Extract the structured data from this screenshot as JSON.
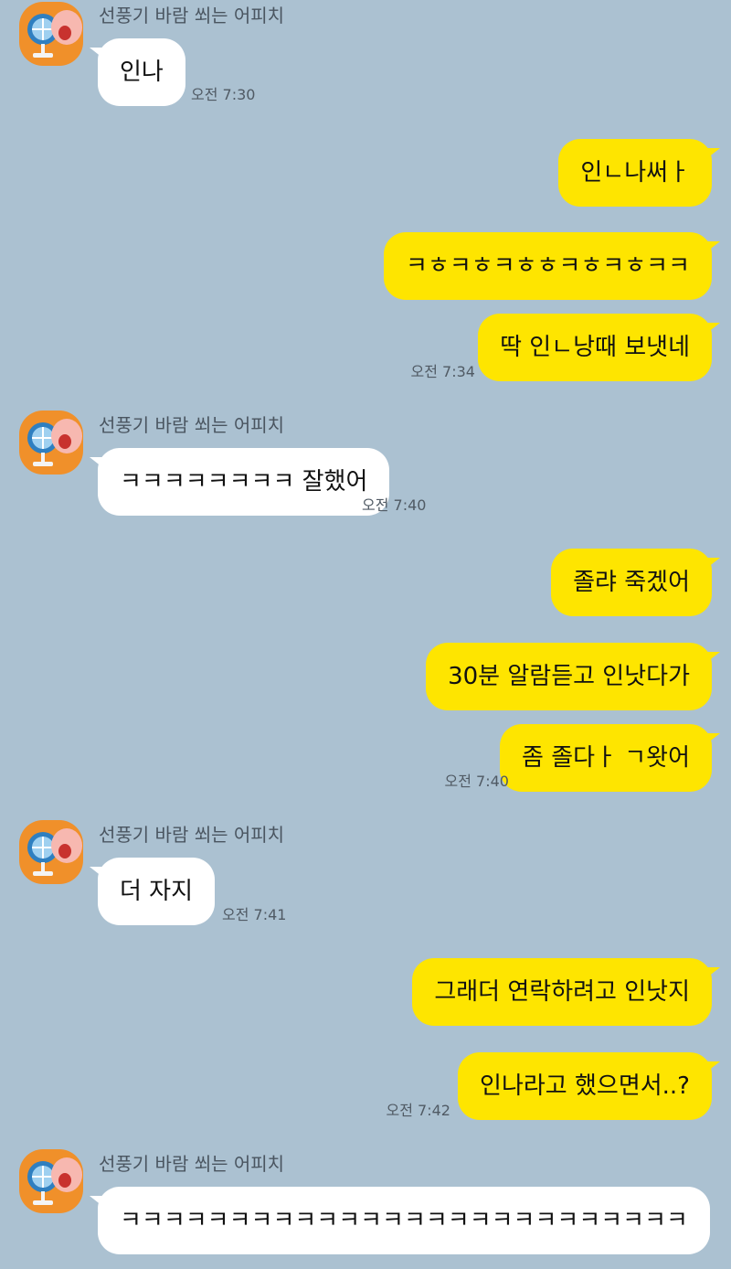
{
  "chat": {
    "contact_name": "선풍기 바람 쐬는 어피치",
    "groups": [
      {
        "messages": [
          "인나"
        ],
        "time": "오전 7:30"
      },
      {
        "messages": [
          "인ㄴ나써ㅏ",
          "ㅋㅎㅋㅎㅋㅎㅎㅋㅎㅋㅎㅋㅋ",
          "딱 인ㄴ낭때 보냇네"
        ],
        "time": "오전 7:34"
      },
      {
        "messages": [
          "ㅋㅋㅋㅋㅋㅋㅋㅋ 잘했어"
        ],
        "time": "오전 7:40"
      },
      {
        "messages": [
          "졸랴 죽겠어",
          "30분 알람듣고 인낫다가",
          "좀 졸다ㅏ ㄱ왓어"
        ],
        "time": "오전 7:40"
      },
      {
        "messages": [
          "더 자지"
        ],
        "time": "오전 7:41"
      },
      {
        "messages": [
          "그래더 연락하려고 인낫지",
          "인나라고 했으면서..?"
        ],
        "time": "오전 7:42"
      },
      {
        "messages": [
          "ㅋㅋㅋㅋㅋㅋㅋㅋㅋㅋㅋㅋㅋㅋㅋㅋㅋㅋㅋㅋㅋㅋㅋㅋㅋㅋ"
        ]
      }
    ]
  },
  "icons": {
    "avatar": "apeach-fan-avatar"
  },
  "colors": {
    "background": "#abc1d1",
    "incoming_bubble": "#ffffff",
    "outgoing_bubble": "#fee500",
    "avatar": "#f0902a"
  }
}
